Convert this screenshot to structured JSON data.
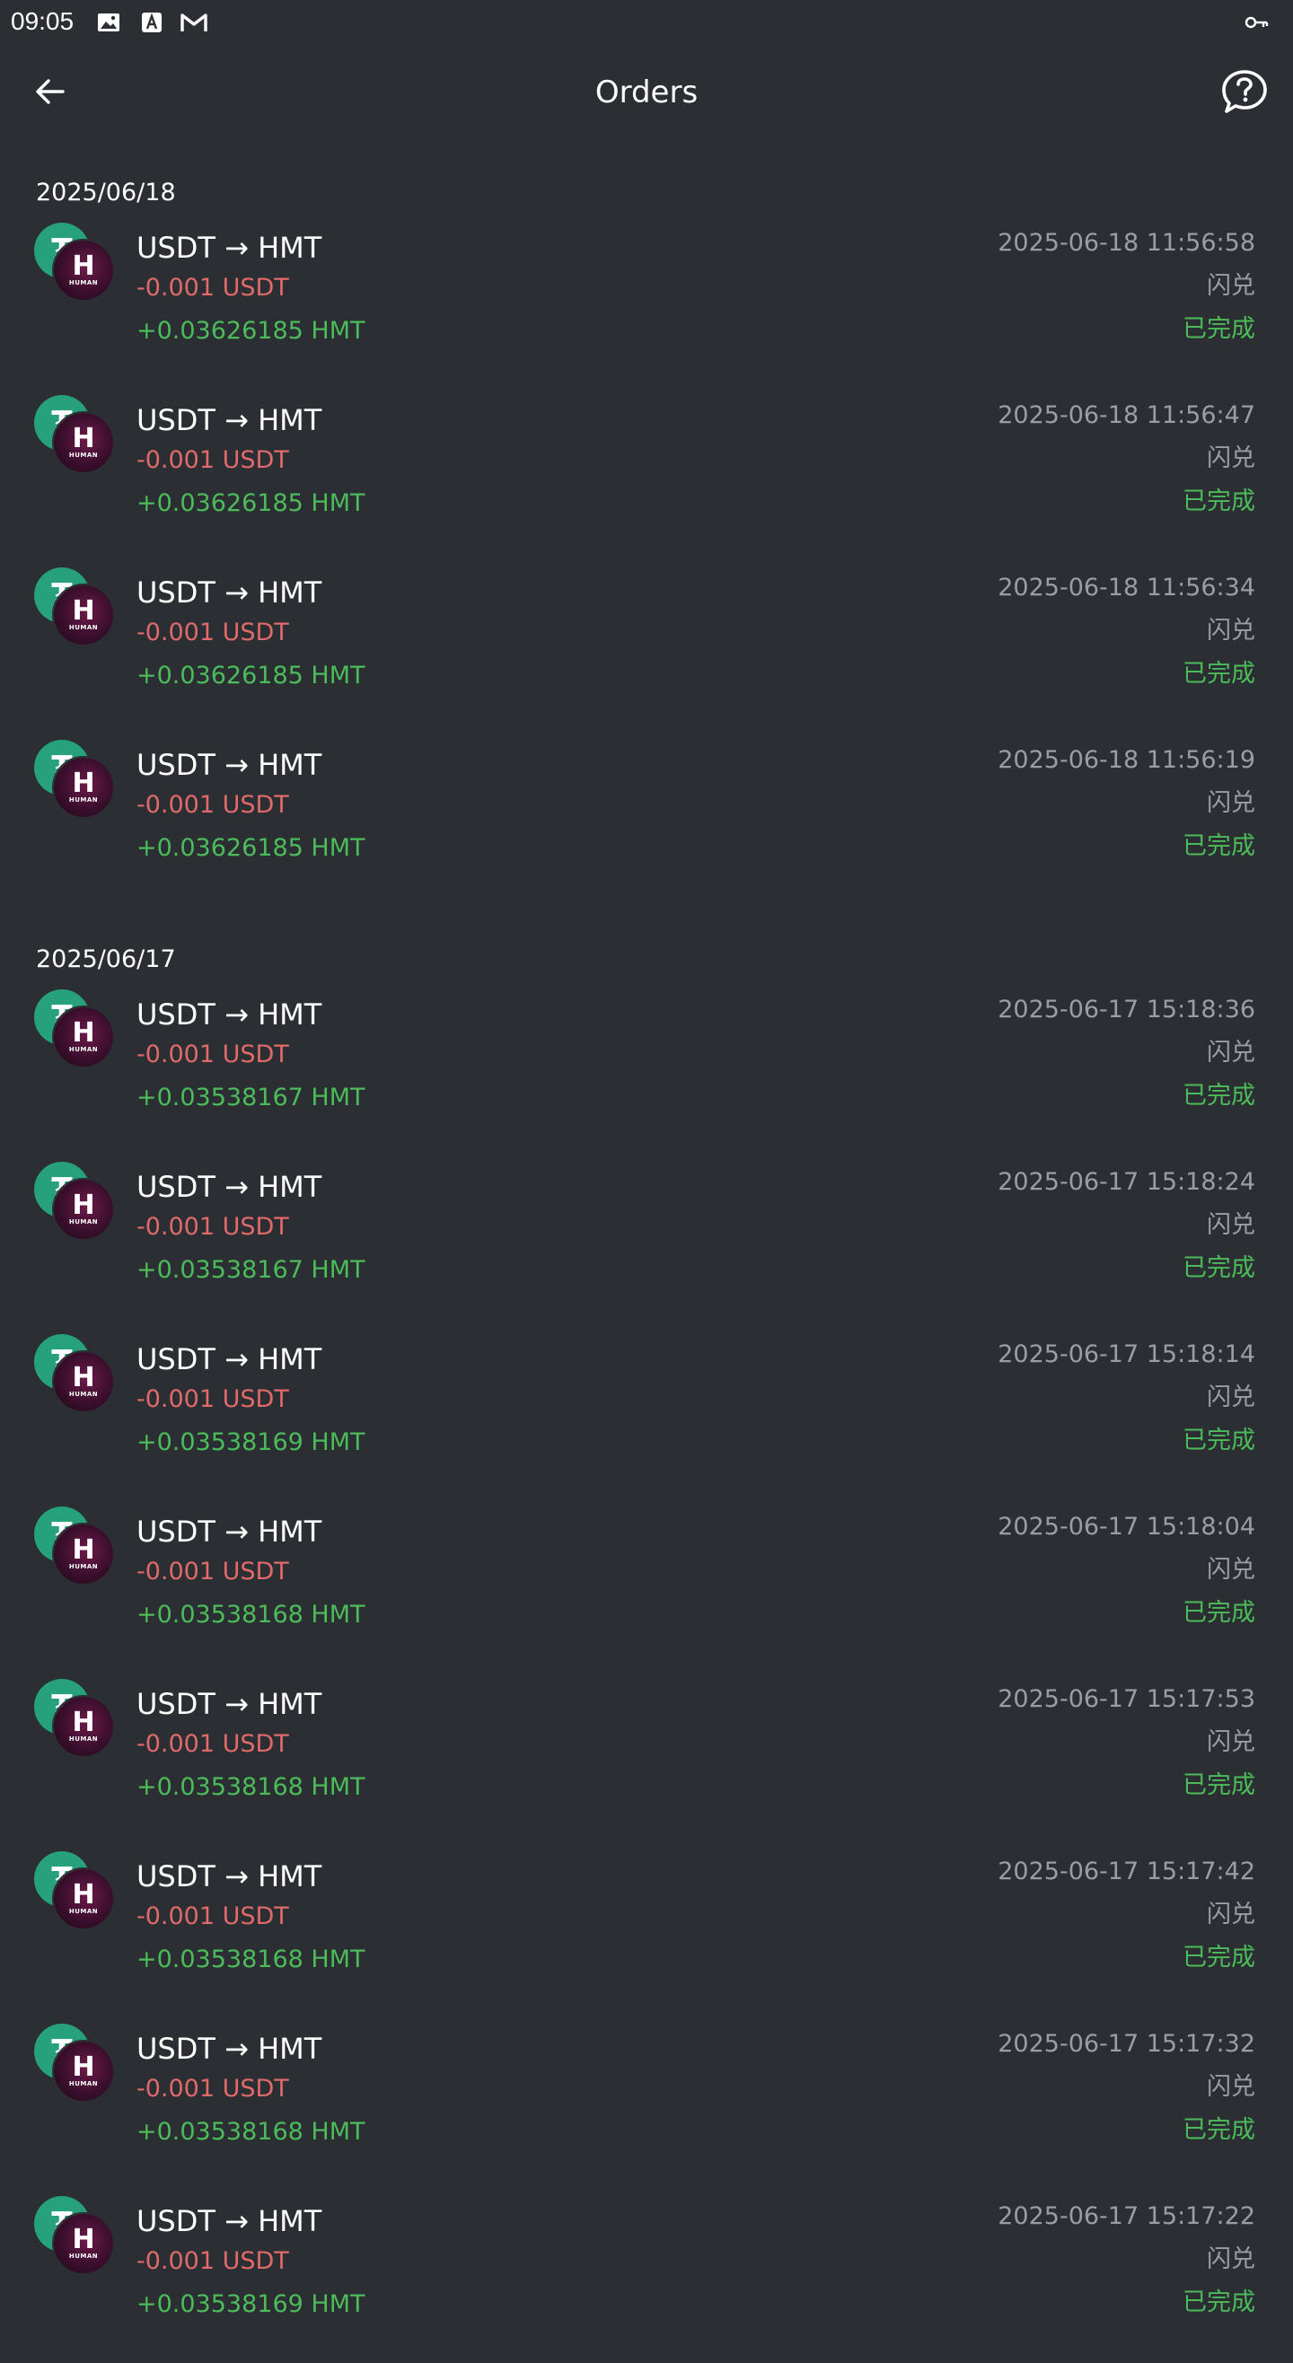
{
  "status_bar": {
    "time": "09:05",
    "icons": [
      "image-icon",
      "font-a-icon",
      "gmail-icon",
      "key-icon"
    ]
  },
  "app_bar": {
    "title": "Orders",
    "back_icon": "arrow-left-icon",
    "help_icon": "help-chat-icon"
  },
  "colors": {
    "background": "#2b2f33",
    "negative": "#e06a6a",
    "positive": "#4cbb5a",
    "muted": "#9a9ea3",
    "usdt": "#26a17b"
  },
  "token_icons": {
    "usdt_glyph": "₮",
    "hmt_glyph": "H",
    "hmt_caption": "HUMAN"
  },
  "groups": [
    {
      "date": "2025/06/18",
      "orders": [
        {
          "pair": "USDT → HMT",
          "out": "-0.001 USDT",
          "in": "+0.03626185 HMT",
          "time": "2025-06-18 11:56:58",
          "type": "闪兑",
          "status": "已完成"
        },
        {
          "pair": "USDT → HMT",
          "out": "-0.001 USDT",
          "in": "+0.03626185 HMT",
          "time": "2025-06-18 11:56:47",
          "type": "闪兑",
          "status": "已完成"
        },
        {
          "pair": "USDT → HMT",
          "out": "-0.001 USDT",
          "in": "+0.03626185 HMT",
          "time": "2025-06-18 11:56:34",
          "type": "闪兑",
          "status": "已完成"
        },
        {
          "pair": "USDT → HMT",
          "out": "-0.001 USDT",
          "in": "+0.03626185 HMT",
          "time": "2025-06-18 11:56:19",
          "type": "闪兑",
          "status": "已完成"
        }
      ]
    },
    {
      "date": "2025/06/17",
      "orders": [
        {
          "pair": "USDT → HMT",
          "out": "-0.001 USDT",
          "in": "+0.03538167 HMT",
          "time": "2025-06-17 15:18:36",
          "type": "闪兑",
          "status": "已完成"
        },
        {
          "pair": "USDT → HMT",
          "out": "-0.001 USDT",
          "in": "+0.03538167 HMT",
          "time": "2025-06-17 15:18:24",
          "type": "闪兑",
          "status": "已完成"
        },
        {
          "pair": "USDT → HMT",
          "out": "-0.001 USDT",
          "in": "+0.03538169 HMT",
          "time": "2025-06-17 15:18:14",
          "type": "闪兑",
          "status": "已完成"
        },
        {
          "pair": "USDT → HMT",
          "out": "-0.001 USDT",
          "in": "+0.03538168 HMT",
          "time": "2025-06-17 15:18:04",
          "type": "闪兑",
          "status": "已完成"
        },
        {
          "pair": "USDT → HMT",
          "out": "-0.001 USDT",
          "in": "+0.03538168 HMT",
          "time": "2025-06-17 15:17:53",
          "type": "闪兑",
          "status": "已完成"
        },
        {
          "pair": "USDT → HMT",
          "out": "-0.001 USDT",
          "in": "+0.03538168 HMT",
          "time": "2025-06-17 15:17:42",
          "type": "闪兑",
          "status": "已完成"
        },
        {
          "pair": "USDT → HMT",
          "out": "-0.001 USDT",
          "in": "+0.03538168 HMT",
          "time": "2025-06-17 15:17:32",
          "type": "闪兑",
          "status": "已完成"
        },
        {
          "pair": "USDT → HMT",
          "out": "-0.001 USDT",
          "in": "+0.03538169 HMT",
          "time": "2025-06-17 15:17:22",
          "type": "闪兑",
          "status": "已完成"
        }
      ]
    }
  ]
}
